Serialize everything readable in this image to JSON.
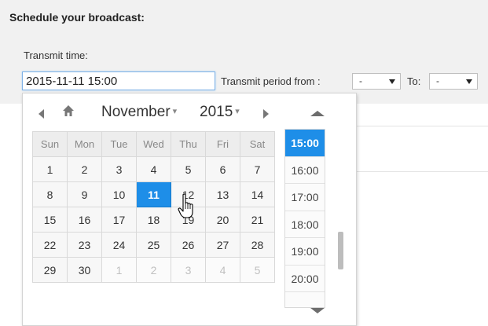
{
  "header": {
    "title": "Schedule your broadcast:"
  },
  "transmit": {
    "label": "Transmit time:",
    "value": "2015-11-11 15:00",
    "period_label": "Transmit period from :",
    "from_value": "-",
    "to_label": "To:",
    "to_value": "-"
  },
  "calendar": {
    "month": "November",
    "year": "2015",
    "weekdays": [
      "Sun",
      "Mon",
      "Tue",
      "Wed",
      "Thu",
      "Fri",
      "Sat"
    ],
    "weeks": [
      [
        "1",
        "2",
        "3",
        "4",
        "5",
        "6",
        "7"
      ],
      [
        "8",
        "9",
        "10",
        "11",
        "12",
        "13",
        "14"
      ],
      [
        "15",
        "16",
        "17",
        "18",
        "19",
        "20",
        "21"
      ],
      [
        "22",
        "23",
        "24",
        "25",
        "26",
        "27",
        "28"
      ],
      [
        "29",
        "30",
        "1",
        "2",
        "3",
        "4",
        "5"
      ]
    ],
    "selected": "11"
  },
  "time_list": {
    "items": [
      "15:00",
      "16:00",
      "17:00",
      "18:00",
      "19:00",
      "20:00"
    ],
    "selected": "15:00"
  },
  "icons": {
    "prev": "arrow-left-icon",
    "home": "home-icon",
    "next": "arrow-right-icon",
    "up": "arrow-up-icon",
    "down": "arrow-down-icon",
    "cursor": "hand-cursor-icon"
  },
  "colors": {
    "accent": "#1e8ee8",
    "panel": "#f1f1f1"
  }
}
